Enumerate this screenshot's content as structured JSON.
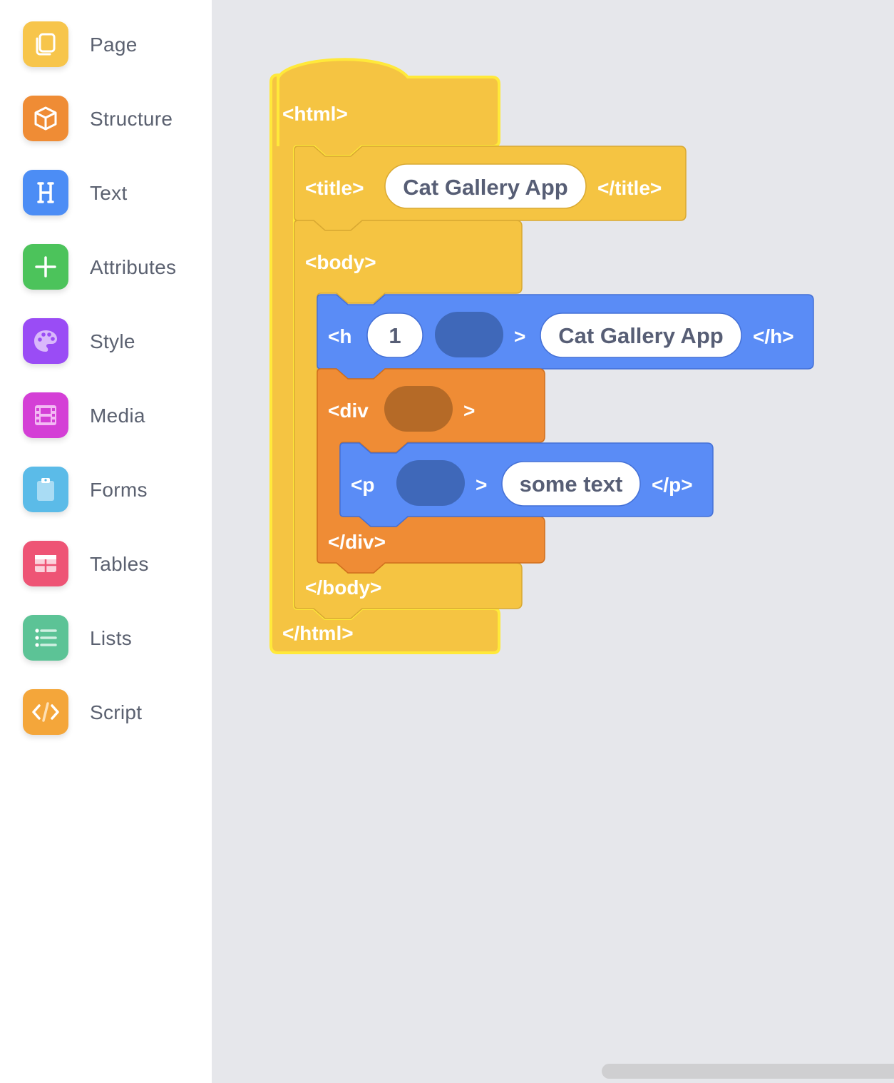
{
  "sidebar": {
    "categories": [
      {
        "label": "Page",
        "icon": "pages-icon",
        "color": "#f7c54b"
      },
      {
        "label": "Structure",
        "icon": "cube-icon",
        "color": "#ef8c35"
      },
      {
        "label": "Text",
        "icon": "heading-icon",
        "color": "#4c8df5"
      },
      {
        "label": "Attributes",
        "icon": "plus-icon",
        "color": "#4cc35b"
      },
      {
        "label": "Style",
        "icon": "palette-icon",
        "color": "#9a4cf5"
      },
      {
        "label": "Media",
        "icon": "film-icon",
        "color": "#d43fd6"
      },
      {
        "label": "Forms",
        "icon": "clipboard-icon",
        "color": "#5bbbe8"
      },
      {
        "label": "Tables",
        "icon": "table-icon",
        "color": "#ee5475"
      },
      {
        "label": "Lists",
        "icon": "list-icon",
        "color": "#5cc396"
      },
      {
        "label": "Script",
        "icon": "code-icon",
        "color": "#f4a63a"
      }
    ]
  },
  "workspace": {
    "html_block": {
      "open": "<html>",
      "close": "</html>",
      "color": "#f5c442",
      "outline": "#ffe93a"
    },
    "title_block": {
      "open": "<title>",
      "value": "Cat Gallery App",
      "close": "</title>"
    },
    "body_block": {
      "open": "<body>",
      "close": "</body>"
    },
    "h_block": {
      "open": "<h",
      "level": "1",
      "gt": ">",
      "value": "Cat Gallery App",
      "close": "</h>",
      "color": "#5a8cf6"
    },
    "div_block": {
      "open": "<div",
      "gt": ">",
      "close": "</div>",
      "color": "#ef8c35"
    },
    "p_block": {
      "open": "<p",
      "gt": ">",
      "value": "some text",
      "close": "</p>",
      "color": "#5a8cf6"
    }
  }
}
